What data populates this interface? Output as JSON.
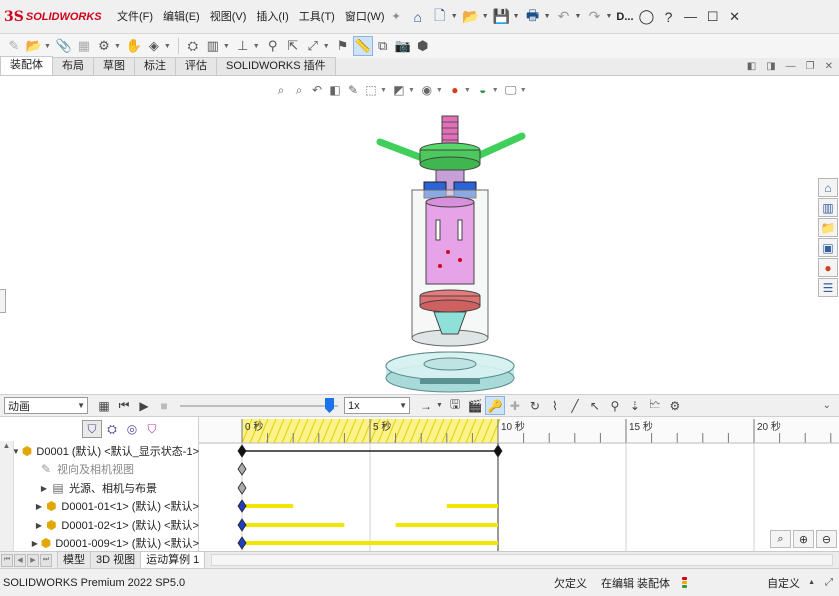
{
  "app": {
    "logo_mark": "3S",
    "logo_text": "SOLIDWORKS"
  },
  "menu": {
    "items": [
      "文件(F)",
      "编辑(E)",
      "视图(V)",
      "插入(I)",
      "工具(T)",
      "窗口(W)"
    ],
    "overflow_label": "D..."
  },
  "tabs": {
    "items": [
      "装配体",
      "布局",
      "草图",
      "标注",
      "评估",
      "SOLIDWORKS 插件"
    ],
    "active": "装配体"
  },
  "motion": {
    "study_type": "动画",
    "playback_speed": "1x"
  },
  "timeline": {
    "time_labels": [
      "0 秒",
      "5 秒",
      "10 秒",
      "15 秒",
      "20 秒"
    ],
    "shaded_end_seconds": 10,
    "bars": [
      {
        "row": 3,
        "segments": [
          [
            0,
            2
          ],
          [
            8,
            10
          ]
        ]
      },
      {
        "row": 4,
        "segments": [
          [
            0,
            4
          ],
          [
            6,
            10
          ]
        ]
      },
      {
        "row": 5,
        "segments": [
          [
            0,
            10
          ]
        ]
      }
    ]
  },
  "tree": {
    "rows": [
      {
        "label": "D0001 (默认) <默认_显示状态-1>",
        "icon": "assembly-icon",
        "expander": "▼"
      },
      {
        "label": "视向及相机视图",
        "icon": "camera-icon",
        "expander": ""
      },
      {
        "label": "光源、相机与布景",
        "icon": "lights-folder-icon",
        "expander": "▶"
      },
      {
        "label": "D0001-01<1> (默认) <默认>",
        "icon": "part-icon",
        "expander": "▶"
      },
      {
        "label": "D0001-02<1> (默认) <默认>",
        "icon": "part-icon",
        "expander": "▶"
      },
      {
        "label": "D0001-009<1> (默认) <默认>",
        "icon": "part-icon",
        "expander": "▶"
      }
    ]
  },
  "bottom_tabs": {
    "items": [
      "模型",
      "3D 视图",
      "运动算例 1"
    ],
    "active": "运动算例 1"
  },
  "status": {
    "app_version": "SOLIDWORKS Premium 2022 SP5.0",
    "under_defined": "欠定义",
    "editing": "在编辑 装配体",
    "custom": "自定义"
  },
  "colors": {
    "brand_red": "#d0021b",
    "key_blue": "#1f3fbf",
    "bar_yellow": "#f2e600",
    "shaded_yellow": "#fbf28c"
  }
}
